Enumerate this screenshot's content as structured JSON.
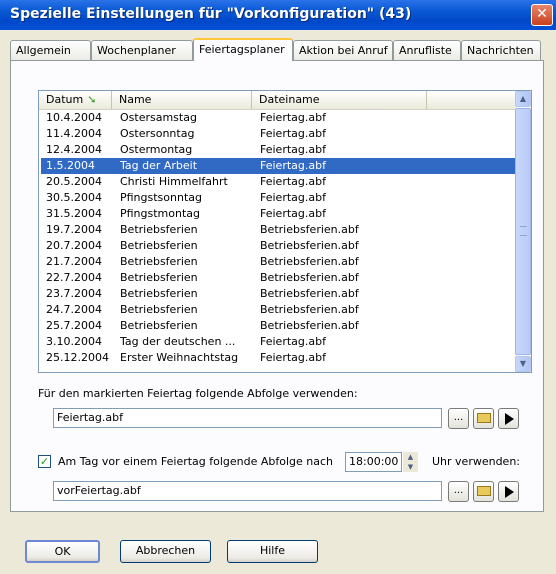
{
  "window": {
    "title": "Spezielle Einstellungen für \"Vorkonfiguration\" (43)",
    "close_icon": "close-icon"
  },
  "tabs": [
    {
      "label": "Allgemein"
    },
    {
      "label": "Wochenplaner"
    },
    {
      "label": "Feiertagsplaner"
    },
    {
      "label": "Aktion bei Anruf"
    },
    {
      "label": "Anrufliste"
    },
    {
      "label": "Nachrichten"
    }
  ],
  "active_tab": "Feiertagsplaner",
  "list": {
    "columns": [
      {
        "label": "Datum",
        "sort_icon": "sort-down-arrow-icon"
      },
      {
        "label": "Name"
      },
      {
        "label": "Dateiname"
      }
    ],
    "rows": [
      {
        "date": "10.4.2004",
        "name": "Ostersamstag",
        "file": "Feiertag.abf"
      },
      {
        "date": "11.4.2004",
        "name": "Ostersonntag",
        "file": "Feiertag.abf"
      },
      {
        "date": "12.4.2004",
        "name": "Ostermontag",
        "file": "Feiertag.abf"
      },
      {
        "date": "1.5.2004",
        "name": "Tag der Arbeit",
        "file": "Feiertag.abf",
        "selected": true
      },
      {
        "date": "20.5.2004",
        "name": "Christi Himmelfahrt",
        "file": "Feiertag.abf"
      },
      {
        "date": "30.5.2004",
        "name": "Pfingstsonntag",
        "file": "Feiertag.abf"
      },
      {
        "date": "31.5.2004",
        "name": "Pfingstmontag",
        "file": "Feiertag.abf"
      },
      {
        "date": "19.7.2004",
        "name": "Betriebsferien",
        "file": "Betriebsferien.abf"
      },
      {
        "date": "20.7.2004",
        "name": "Betriebsferien",
        "file": "Betriebsferien.abf"
      },
      {
        "date": "21.7.2004",
        "name": "Betriebsferien",
        "file": "Betriebsferien.abf"
      },
      {
        "date": "22.7.2004",
        "name": "Betriebsferien",
        "file": "Betriebsferien.abf"
      },
      {
        "date": "23.7.2004",
        "name": "Betriebsferien",
        "file": "Betriebsferien.abf"
      },
      {
        "date": "24.7.2004",
        "name": "Betriebsferien",
        "file": "Betriebsferien.abf"
      },
      {
        "date": "25.7.2004",
        "name": "Betriebsferien",
        "file": "Betriebsferien.abf"
      },
      {
        "date": "3.10.2004",
        "name": "Tag der deutschen ...",
        "file": "Feiertag.abf"
      },
      {
        "date": "25.12.2004",
        "name": "Erster Weihnachtstag",
        "file": "Feiertag.abf"
      }
    ]
  },
  "holiday_sequence": {
    "label": "Für den markierten Feiertag folgende Abfolge verwenden:",
    "value": "Feiertag.abf",
    "browse_label": "...",
    "open_icon": "open-folder-icon",
    "play_icon": "play-icon"
  },
  "eve_sequence": {
    "checked": true,
    "label_before": "Am Tag vor einem Feiertag folgende Abfolge nach",
    "time": "18:00:00",
    "label_after": "Uhr verwenden:",
    "value": "vorFeiertag.abf",
    "browse_label": "...",
    "open_icon": "open-folder-icon",
    "play_icon": "play-icon"
  },
  "buttons": {
    "ok": "OK",
    "cancel": "Abbrechen",
    "help": "Hilfe"
  }
}
